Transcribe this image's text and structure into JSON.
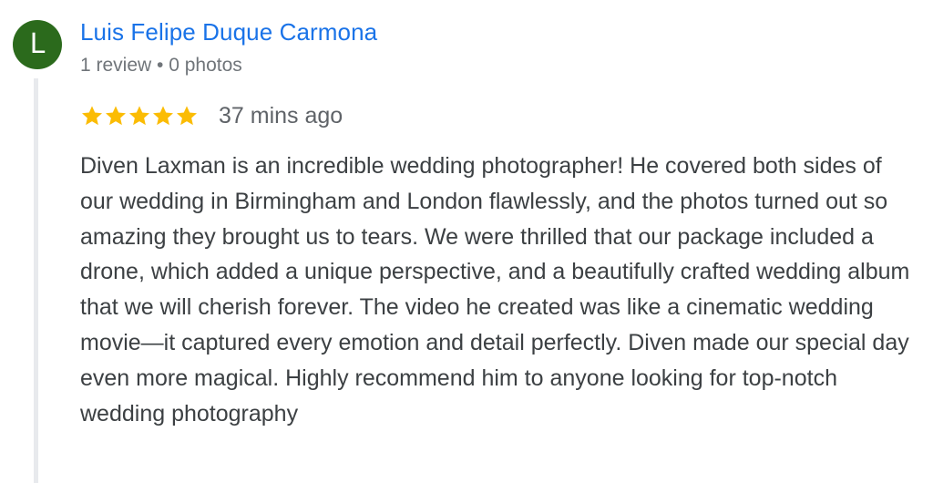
{
  "reviewer": {
    "avatar_letter": "L",
    "avatar_color": "#2b6a1c",
    "name": "Luis Felipe Duque Carmona",
    "meta": "1 review • 0 photos"
  },
  "rating": {
    "stars": 5,
    "max_stars": 5,
    "star_color": "#fbbc04",
    "time_ago": "37 mins ago"
  },
  "review": {
    "text": "Diven Laxman is an incredible wedding photographer! He covered both sides of our wedding in Birmingham and London flawlessly, and the photos turned out so amazing they brought us to tears. We were thrilled that our package included a drone, which added a unique perspective, and a beautifully crafted wedding album that we will cherish forever. The video he created was like a cinematic wedding movie—it captured every emotion and detail perfectly. Diven made our special day even more magical. Highly recommend him to anyone looking for top-notch wedding photography"
  },
  "colors": {
    "name_link": "#1a73e8",
    "meta_text": "#70757a",
    "body_text": "#3c4043",
    "thread_line": "#e8eaed"
  }
}
